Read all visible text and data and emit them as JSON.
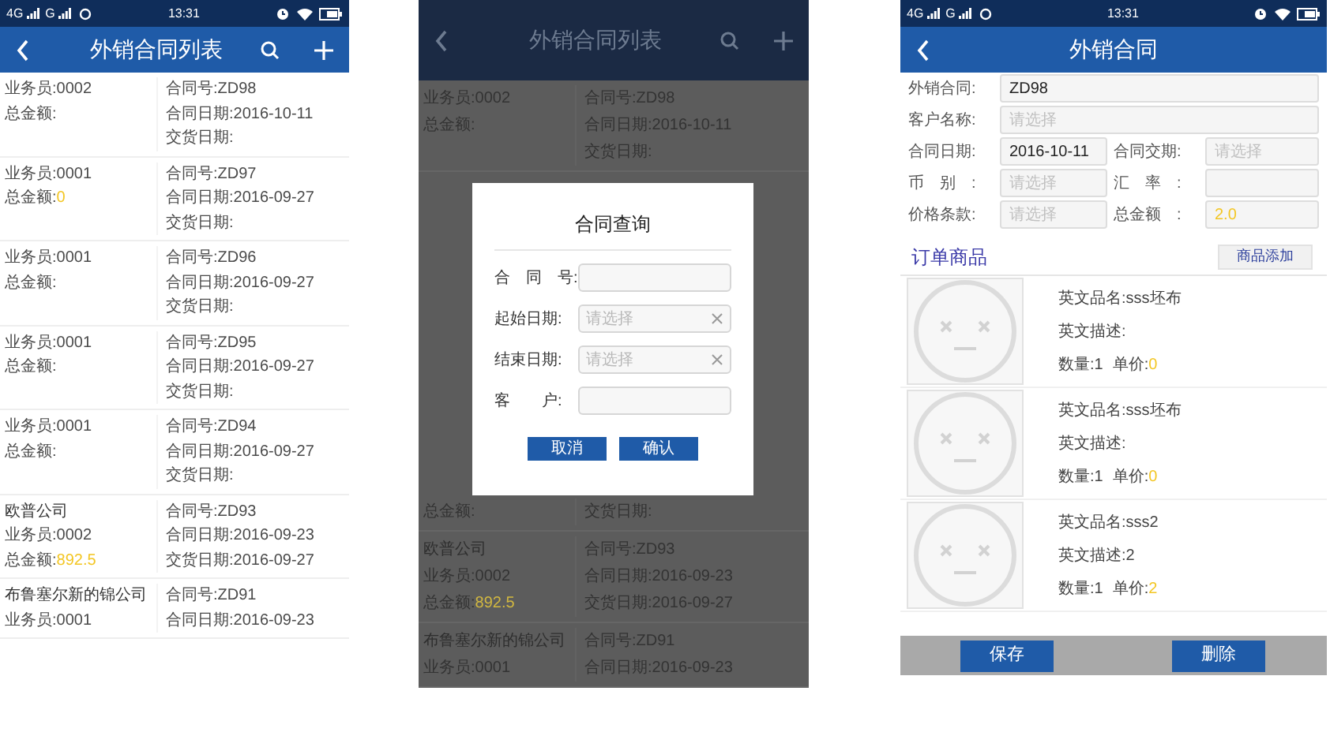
{
  "list_screen": {
    "status_bar": {
      "network_1": "4G",
      "network_2": "G",
      "time": "13:31"
    },
    "title": "外销合同列表",
    "rows": [
      {
        "salesman": "业务员:0002",
        "amount_label": "总金额:",
        "contract_no": "合同号:ZD98",
        "contract_date": "合同日期:2016-10-11",
        "delivery_date": "交货日期:"
      },
      {
        "salesman": "业务员:0001",
        "amount_label": "总金额:",
        "amount": "0",
        "contract_no": "合同号:ZD97",
        "contract_date": "合同日期:2016-09-27",
        "delivery_date": "交货日期:"
      },
      {
        "salesman": "业务员:0001",
        "amount_label": "总金额:",
        "contract_no": "合同号:ZD96",
        "contract_date": "合同日期:2016-09-27",
        "delivery_date": "交货日期:"
      },
      {
        "salesman": "业务员:0001",
        "amount_label": "总金额:",
        "contract_no": "合同号:ZD95",
        "contract_date": "合同日期:2016-09-27",
        "delivery_date": "交货日期:"
      },
      {
        "salesman": "业务员:0001",
        "amount_label": "总金额:",
        "contract_no": "合同号:ZD94",
        "contract_date": "合同日期:2016-09-27",
        "delivery_date": "交货日期:"
      },
      {
        "company": "欧普公司",
        "salesman": "业务员:0002",
        "amount_label": "总金额:",
        "amount": "892.5",
        "contract_no": "合同号:ZD93",
        "contract_date": "合同日期:2016-09-23",
        "delivery_date": "交货日期:2016-09-27"
      },
      {
        "company": "布鲁塞尔新的锦公司",
        "salesman": "业务员:0001",
        "contract_no": "合同号:ZD91",
        "contract_date": "合同日期:2016-09-23"
      }
    ]
  },
  "search_screen": {
    "title": "外销合同列表",
    "rows": [
      {
        "kind": "full",
        "salesman": "业务员:0002",
        "amount_label": "总金额:",
        "contract_no": "合同号:ZD98",
        "contract_date": "合同日期:2016-10-11",
        "delivery_date": "交货日期:"
      },
      {
        "kind": "partial",
        "amount_label": "总金额:",
        "delivery_date": "交货日期:"
      },
      {
        "kind": "full",
        "company": "欧普公司",
        "salesman": "业务员:0002",
        "amount_label": "总金额:",
        "amount": "892.5",
        "contract_no": "合同号:ZD93",
        "contract_date": "合同日期:2016-09-23",
        "delivery_date": "交货日期:2016-09-27"
      },
      {
        "kind": "full",
        "company": "布鲁塞尔新的锦公司",
        "salesman": "业务员:0001",
        "contract_no": "合同号:ZD91",
        "contract_date": "合同日期:2016-09-23"
      }
    ],
    "dialog": {
      "title": "合同查询",
      "fields": [
        {
          "label": "合　同　号:",
          "clearable": false
        },
        {
          "label": "起始日期:",
          "placeholder": "请选择",
          "clearable": true
        },
        {
          "label": "结束日期:",
          "placeholder": "请选择",
          "clearable": true
        },
        {
          "label": "客　　户:",
          "clearable": false
        }
      ],
      "buttons": [
        "取消",
        "确认"
      ]
    }
  },
  "detail_screen": {
    "status_bar": {
      "network_1": "4G",
      "network_2": "G",
      "time": "13:31"
    },
    "title": "外销合同",
    "form_rows": [
      [
        {
          "label": "外销合同:",
          "value": "ZD98",
          "kind": "text"
        }
      ],
      [
        {
          "label": "客户名称:",
          "placeholder": "请选择",
          "kind": "text"
        }
      ],
      [
        {
          "label": "合同日期:",
          "value": "2016-10-11",
          "kind": "text"
        },
        {
          "label": "合同交期:",
          "placeholder": "请选择",
          "kind": "text"
        }
      ],
      [
        {
          "label": "币　别　:",
          "placeholder": "请选择",
          "kind": "text"
        },
        {
          "label": "汇　率　:",
          "kind": "text"
        }
      ],
      [
        {
          "label": "价格条款:",
          "placeholder": "请选择",
          "kind": "text"
        },
        {
          "label": "总金额　:",
          "value": "2.0",
          "kind": "amount"
        }
      ]
    ],
    "section_title": "订单商品",
    "add_button": "商品添加",
    "products": [
      {
        "name": "英文品名:sss坯布",
        "description": "英文描述:",
        "quantity": "数量:1",
        "price_label": "单价:",
        "price": "0"
      },
      {
        "name": "英文品名:sss坯布",
        "description": "英文描述:",
        "quantity": "数量:1",
        "price_label": "单价:",
        "price": "0"
      },
      {
        "name": "英文品名:sss2",
        "description": "英文描述:2",
        "quantity": "数量:1",
        "price_label": "单价:",
        "price": "2"
      }
    ],
    "buttons": [
      "保存",
      "删除"
    ]
  }
}
